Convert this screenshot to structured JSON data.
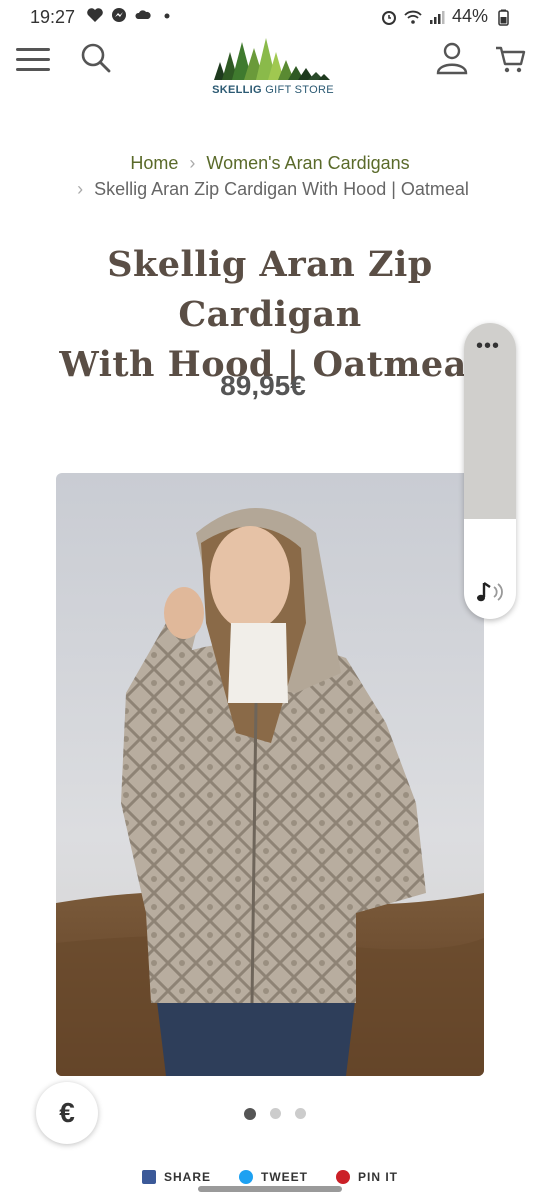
{
  "status_bar": {
    "time": "19:27",
    "battery": "44%",
    "left_icons": [
      "heart-icon",
      "messenger-icon",
      "cloud-icon",
      "dot-icon"
    ],
    "right_icons": [
      "alarm-icon",
      "wifi-icon",
      "signal-icon",
      "battery-icon"
    ]
  },
  "header": {
    "logo_brand": "SKELLIG",
    "logo_sub": "GIFT STORE",
    "icons": [
      "menu-icon",
      "search-icon",
      "account-icon",
      "cart-icon"
    ]
  },
  "breadcrumb": {
    "home": "Home",
    "category": "Women's Aran Cardigans",
    "current": "Skellig Aran Zip Cardigan With Hood | Oatmeal",
    "separator": ">"
  },
  "product": {
    "title_line1": "Skellig Aran Zip Cardigan",
    "title_line2": "With Hood | Oatmeal",
    "price": "89,95€"
  },
  "side_widget": {
    "dots": "•••",
    "icon": "sound-icon"
  },
  "carousel": {
    "total": 3,
    "active": 1
  },
  "currency_button": {
    "label": "€"
  },
  "share": {
    "share_label": "SHARE",
    "tweet_label": "TWEET",
    "pin_label": "PIN IT"
  },
  "colors": {
    "accent": "#5a6a2a",
    "title": "#5a4e45",
    "price": "#555555",
    "logo_blue": "#2c5a73",
    "facebook": "#3b5998",
    "twitter": "#1da1f2",
    "pinterest": "#cb2027"
  }
}
